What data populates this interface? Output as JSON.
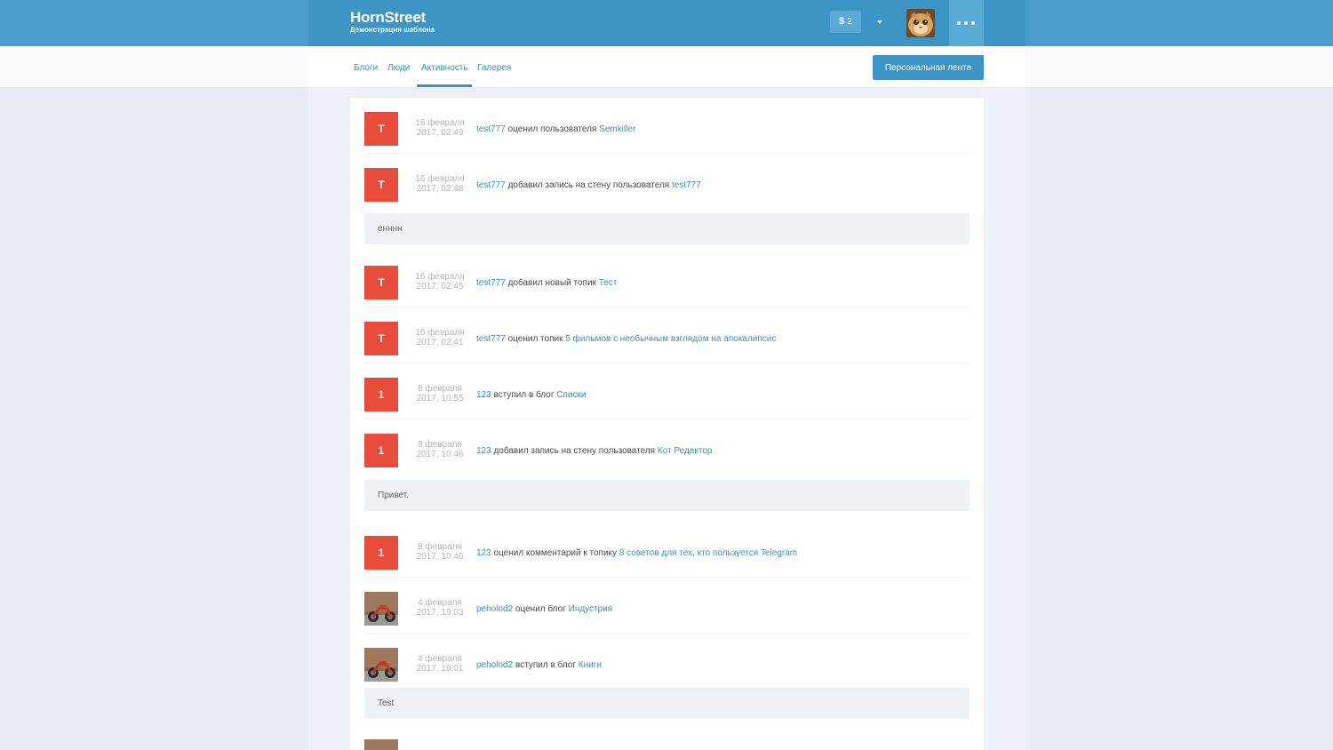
{
  "header": {
    "logo_title": "HornStreet",
    "logo_subtitle": "Демонстрация шаблона",
    "wallet_symbol": "$",
    "wallet_count": "2"
  },
  "subnav": {
    "tabs": [
      {
        "label": "Блоги",
        "active": false
      },
      {
        "label": "Люди",
        "active": false
      },
      {
        "label": "Активность",
        "active": true
      },
      {
        "label": "Галерея",
        "active": false
      }
    ],
    "feed_button": "Персональная лента"
  },
  "colors": {
    "topbar": "#3d95c6",
    "link": "#3d8fbd",
    "avatar_letter_bg": "#e84c3d"
  },
  "activity": [
    {
      "avatar_letter": "T",
      "date": "16 февраля",
      "time": "2017, 02:49",
      "user": "test777",
      "action": "оценил пользователя",
      "target": "Semkiller"
    },
    {
      "avatar_letter": "T",
      "date": "16 февраля",
      "time": "2017, 02:48",
      "user": "test777",
      "action": "добавил запись на стену пользователя",
      "target": "test777",
      "quote": "енннн"
    },
    {
      "avatar_letter": "T",
      "date": "16 февраля",
      "time": "2017, 02:45",
      "user": "test777",
      "action": "добавил новый топик",
      "target": "Тест"
    },
    {
      "avatar_letter": "T",
      "date": "16 февраля",
      "time": "2017, 02:41",
      "user": "test777",
      "action": "оценил топик",
      "target": "5 фильмов с необычным взглядом на апокалипсис"
    },
    {
      "avatar_letter": "1",
      "date": "8 февраля",
      "time": "2017, 10:55",
      "user": "123",
      "action": "вступил в блог",
      "target": "Списки"
    },
    {
      "avatar_letter": "1",
      "date": "8 февраля",
      "time": "2017, 10:46",
      "user": "123",
      "action": "добавил запись на стену пользователя",
      "target": "Кот Редактор",
      "quote": "Привет."
    },
    {
      "avatar_letter": "1",
      "date": "8 февраля",
      "time": "2017, 10:46",
      "user": "123",
      "action": "оценил комментарий к топику",
      "target": "8 советов для тех, кто пользуется Telegram"
    },
    {
      "avatar_photo": "motorcycle-photo",
      "date": "4 февраля",
      "time": "2017, 19:03",
      "user": "peholod2",
      "action": "оценил блог",
      "target": "Индустрия"
    },
    {
      "avatar_photo": "motorcycle-photo",
      "date": "4 февраля",
      "time": "2017, 19:01",
      "user": "peholod2",
      "action": "вступил в блог",
      "target": "Книги",
      "quote": "Test"
    }
  ]
}
